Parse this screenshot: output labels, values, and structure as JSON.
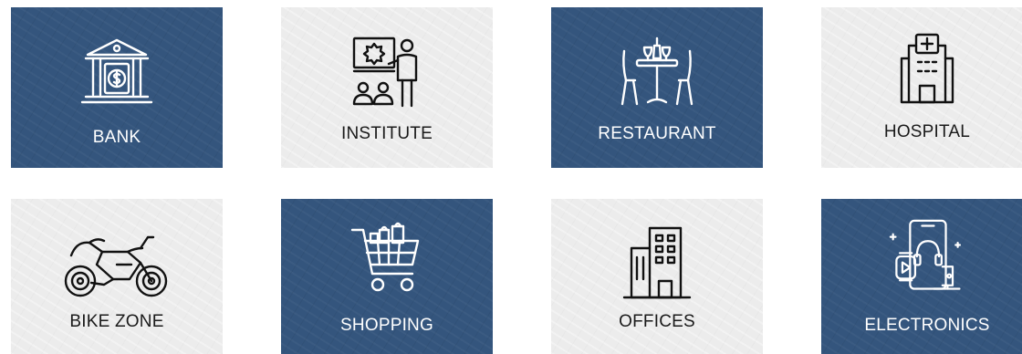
{
  "colors": {
    "dark_tile": "#34557d",
    "light_tile": "#ececec",
    "white_text": "#ffffff",
    "dark_text": "#1a1a1a"
  },
  "categories": [
    {
      "label": "BANK",
      "icon": "bank-icon",
      "theme": "dark"
    },
    {
      "label": "INSTITUTE",
      "icon": "presentation-icon",
      "theme": "light"
    },
    {
      "label": "RESTAURANT",
      "icon": "restaurant-table-icon",
      "theme": "dark"
    },
    {
      "label": "HOSPITAL",
      "icon": "hospital-icon",
      "theme": "light"
    },
    {
      "label": "BIKE ZONE",
      "icon": "motorbike-icon",
      "theme": "light"
    },
    {
      "label": "SHOPPING",
      "icon": "shopping-cart-icon",
      "theme": "dark"
    },
    {
      "label": "OFFICES",
      "icon": "office-building-icon",
      "theme": "light"
    },
    {
      "label": "ELECTRONICS",
      "icon": "electronics-devices-icon",
      "theme": "dark"
    }
  ]
}
